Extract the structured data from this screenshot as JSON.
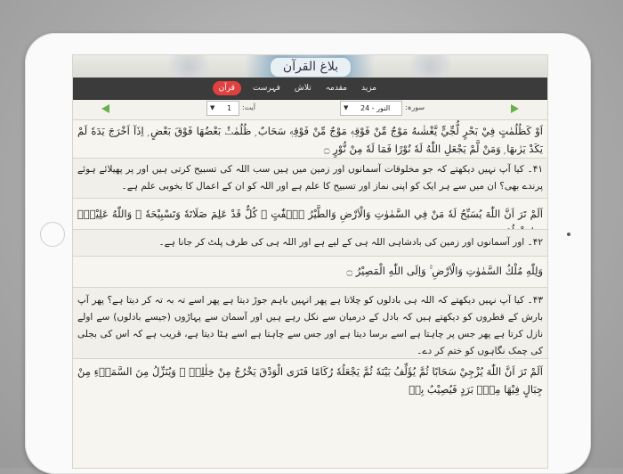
{
  "app": {
    "logo_text": "بلاغ القرآن"
  },
  "nav": {
    "items": [
      {
        "label": "قرآن",
        "active": true
      },
      {
        "label": "فہرست",
        "active": false
      },
      {
        "label": "تلاش",
        "active": false
      },
      {
        "label": "مقدمہ",
        "active": false
      },
      {
        "label": "مزید",
        "active": false
      }
    ]
  },
  "toolbar": {
    "surah_label": "سورہ:",
    "surah_value": "24 - النور",
    "ayat_label": "آیت:",
    "ayat_value": "1",
    "caret": "▼"
  },
  "content": {
    "rows": [
      {
        "type": "arabic",
        "text": "اَوْ كَظُلُمٰتٍ فِيْ بَحْرٍ لُّجِّيٍّ يَّغْشٰىهُ مَوْجٌ مِّنْ فَوْقِهٖ مَوْجٌ مِّنْ فَوْقِهٖ سَحَابٌ ۭ ظُلُمٰتٌۢ بَعْضُهَا فَوْقَ بَعْضٍ ۭ اِذَآ اَخْرَجَ يَدَهٗ لَمْ يَكَدْ يَرٰىهَا ۭ وَمَنْ لَّمْ يَجْعَلِ اللّٰهُ لَهٗ نُوْرًا فَمَا لَهٗ مِنْ نُّوْرٍ ۝"
      },
      {
        "type": "urdu",
        "text": "۴۱۔ کیا آپ نہیں دیکھتے کہ جو مخلوقات آسمانوں اور زمین میں ہیں سب اللہ کی تسبیح کرتی ہیں اور پر پھیلائے ہوئے پرندے بھی؟ ان میں سے ہر ایک کو اپنی نماز اور تسبیح کا علم ہے اور اللہ کو ان کے اعمال کا بخوبی علم ہے۔"
      },
      {
        "type": "arabic",
        "text": "اَلَمْ تَرَ اَنَّ اللّٰهَ يُسَبِّحُ لَهٗ مَنْ فِي السَّمٰوٰتِ وَالْاَرْضِ وَالطَّيْرُ صٰۗفّٰتٍ ۭ كُلٌّ قَدْ عَلِمَ صَلَاتَهٗ وَتَسْبِيْحَهٗ ۭ وَاللّٰهُ عَلِيْمٌۢ بِمَا يَفْعَلُوْنَ ۝"
      },
      {
        "type": "urdu",
        "text": "۴۲۔ اور آسمانوں اور زمین کی بادشاہی اللہ ہی کے لیے ہے اور اللہ ہی کی طرف پلٹ کر جانا ہے۔"
      },
      {
        "type": "arabic",
        "text": "وَلِلّٰهِ مُلْكُ السَّمٰوٰتِ وَالْاَرْضِ ۚ وَاِلَى اللّٰهِ الْمَصِيْرُ ۝"
      },
      {
        "type": "urdu",
        "text": "۴۳۔ کیا آپ نہیں دیکھتے کہ اللہ ہی بادلوں کو چلاتا ہے پھر انہیں باہم جوڑ دیتا ہے پھر اسے تہ بہ تہ کر دیتا ہے؟ پھر آپ بارش کے قطروں کو دیکھتے ہیں کہ بادل کے درمیان سے نکل رہے ہیں اور آسمان سے پہاڑوں (جیسے بادلوں) سے اولے نازل کرتا ہے پھر جس پر چاہتا ہے اسے برسا دیتا ہے اور جس سے چاہتا ہے اسے ہٹا دیتا ہے، قریب ہے کہ اس کی بجلی کی چمک نگاہوں کو ختم کر دے۔"
      },
      {
        "type": "arabic",
        "text": "اَلَمْ تَرَ اَنَّ اللّٰهَ يُزْجِيْ سَحَابًا ثُمَّ يُؤَلِّفُ بَيْنَهٗ ثُمَّ يَجْعَلُهٗ رُكَامًا فَتَرَى الْوَدْقَ يَخْرُجُ مِنْ خِلٰلِهٖ ۚ وَيُنَزِّلُ مِنَ السَّمَاۗءِ مِنْ جِبَالٍ فِيْهَا مِنْۢ بَرَدٍ فَيُصِيْبُ بِهٖ"
      }
    ]
  }
}
